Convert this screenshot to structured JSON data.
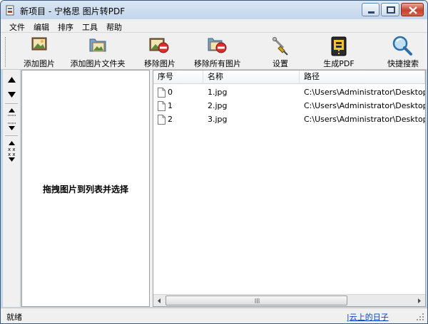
{
  "window": {
    "title": "新项目 - 宁格思 图片转PDF"
  },
  "menu": [
    "文件",
    "编辑",
    "排序",
    "工具",
    "帮助"
  ],
  "toolbar": [
    {
      "label": "添加图片",
      "icon": "add-image-icon"
    },
    {
      "label": "添加图片文件夹",
      "icon": "add-folder-icon"
    },
    {
      "label": "移除图片",
      "icon": "remove-image-icon"
    },
    {
      "label": "移除所有图片",
      "icon": "remove-all-icon"
    },
    {
      "label": "设置",
      "icon": "settings-icon"
    },
    {
      "label": "生成PDF",
      "icon": "generate-pdf-icon"
    },
    {
      "label": "快捷搜索",
      "icon": "search-icon"
    }
  ],
  "side_tools": [
    "move-up-icon",
    "move-down-icon",
    "move-top-icon",
    "move-bottom-icon",
    "sort-icon"
  ],
  "left_panel": {
    "hint": "拖拽图片到列表并选择"
  },
  "table": {
    "columns": [
      "序号",
      "名称",
      "路径"
    ],
    "rows": [
      {
        "index": "0",
        "name": "1.jpg",
        "path": "C:\\Users\\Administrator\\Desktop"
      },
      {
        "index": "1",
        "name": "2.jpg",
        "path": "C:\\Users\\Administrator\\Desktop"
      },
      {
        "index": "2",
        "name": "3.jpg",
        "path": "C:\\Users\\Administrator\\Desktop"
      }
    ]
  },
  "status": {
    "text": "就绪",
    "link": "|云上的日子"
  },
  "colors": {
    "title_bar": "#c2d5ea",
    "close_button": "#c4432d",
    "link": "#0645c8"
  }
}
